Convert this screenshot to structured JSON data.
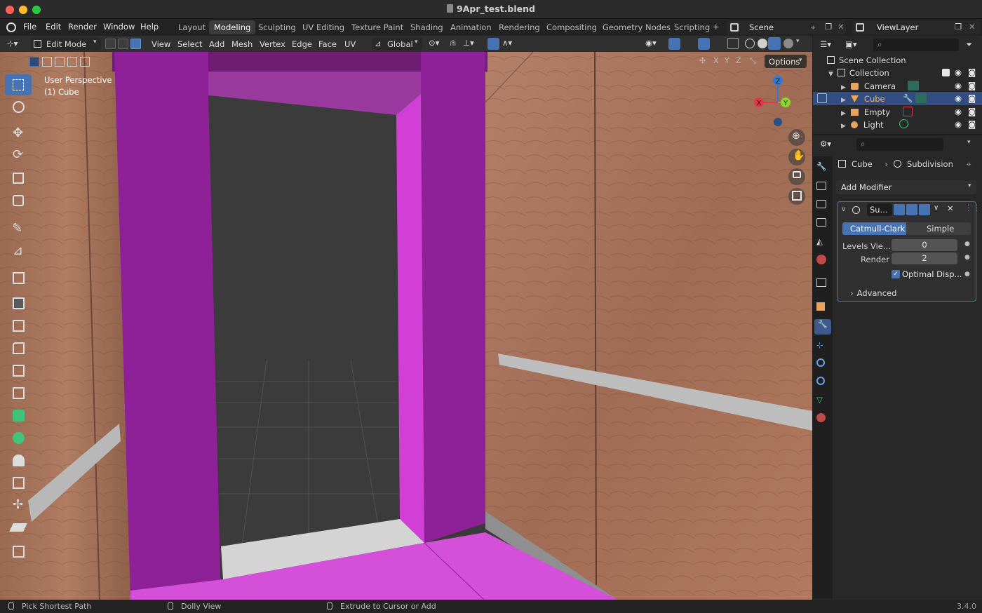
{
  "window": {
    "title": "9Apr_test.blend"
  },
  "menu": [
    "File",
    "Edit",
    "Render",
    "Window",
    "Help"
  ],
  "workspaces": [
    "Layout",
    "Modeling",
    "Sculpting",
    "UV Editing",
    "Texture Paint",
    "Shading",
    "Animation",
    "Rendering",
    "Compositing",
    "Geometry Nodes",
    "Scripting"
  ],
  "active_workspace": "Modeling",
  "scene": "Scene",
  "view_layer": "ViewLayer",
  "viewport_header": {
    "mode": "Edit Mode",
    "menus": [
      "View",
      "Select",
      "Add",
      "Mesh",
      "Vertex",
      "Edge",
      "Face",
      "UV"
    ],
    "orientation": "Global",
    "axes": [
      "X",
      "Y",
      "Z"
    ],
    "options": "Options"
  },
  "viewport": {
    "perspective": "User Perspective",
    "object": "(1) Cube",
    "gizmo": {
      "x": "X",
      "y": "Y",
      "z": "Z"
    }
  },
  "outliner": {
    "root": "Scene Collection",
    "collection": "Collection",
    "items": [
      {
        "name": "Camera",
        "color": "#e8a35c"
      },
      {
        "name": "Cube",
        "color": "#f0a64a",
        "selected": true
      },
      {
        "name": "Empty",
        "color": "#e8a35c"
      },
      {
        "name": "Light",
        "color": "#e8a35c"
      }
    ]
  },
  "properties": {
    "breadcrumb_object": "Cube",
    "breadcrumb_modifier": "Subdivision",
    "add_modifier": "Add Modifier",
    "modifier_name": "Su...",
    "tabs": [
      "Catmull-Clark",
      "Simple"
    ],
    "levels_label": "Levels Vie...",
    "levels_value": "0",
    "render_label": "Render",
    "render_value": "2",
    "optimal_label": "Optimal Disp...",
    "optimal_checked": true,
    "advanced": "Advanced"
  },
  "status": {
    "left": "Pick Shortest Path",
    "middle": "Dolly View",
    "right": "Extrude to Cursor or Add",
    "version": "3.4.0"
  },
  "colors": {
    "accent": "#4772b3",
    "magenta": "#cc3fd0",
    "wood": "#a8725a"
  }
}
